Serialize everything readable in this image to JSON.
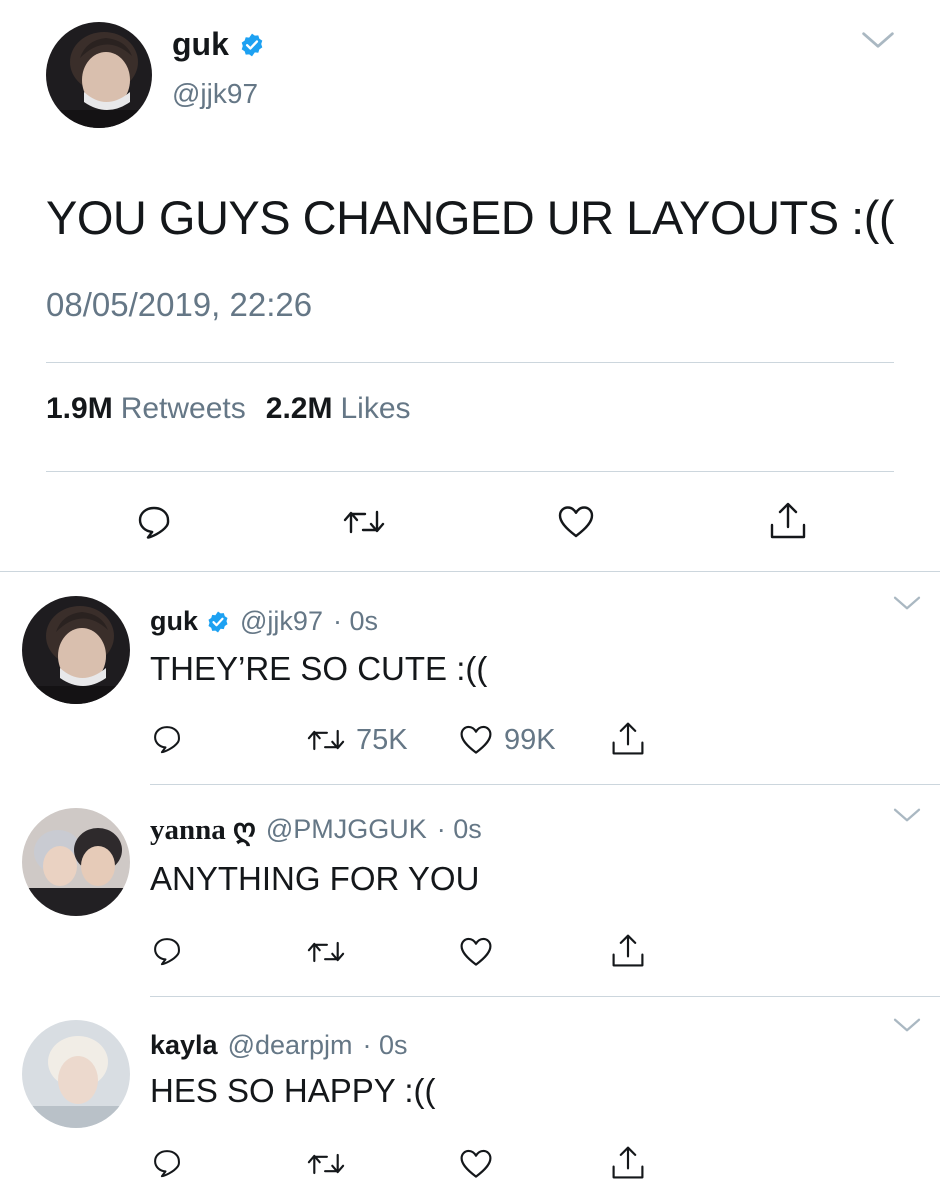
{
  "main_tweet": {
    "author_name": "guk",
    "handle": "@jjk97",
    "text": "YOU GUYS CHANGED UR LAYOUTS :((",
    "timestamp": "08/05/2019, 22:26",
    "retweets_count": "1.9M",
    "retweets_label": "Retweets",
    "likes_count": "2.2M",
    "likes_label": "Likes"
  },
  "replies": [
    {
      "name": "guk",
      "verified": true,
      "handle": "@jjk97",
      "time": "· 0s",
      "text": "THEY’RE SO CUTE :((",
      "retweets": "75K",
      "likes": "99K"
    },
    {
      "name": "yanna ღ",
      "verified": false,
      "handle": "@PMJGGUK",
      "time": "· 0s",
      "text": "ANYTHING FOR YOU",
      "retweets": "",
      "likes": ""
    },
    {
      "name": "kayla",
      "verified": false,
      "handle": "@dearpjm",
      "time": "· 0s",
      "text": "HES SO HAPPY :((",
      "retweets": "",
      "likes": ""
    }
  ],
  "icons": {
    "reply": "reply-icon",
    "retweet": "retweet-icon",
    "like": "heart-icon",
    "share": "share-icon",
    "verified": "verified-badge-icon",
    "more": "chevron-down-icon"
  },
  "colors": {
    "text": "#14171a",
    "secondary": "#657786",
    "verified_blue": "#1da1f2",
    "divider": "#ccd6dd"
  }
}
